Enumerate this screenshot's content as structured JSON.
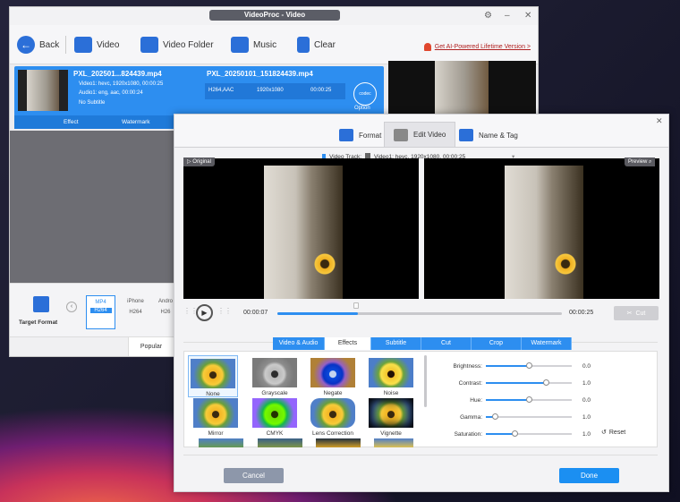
{
  "main": {
    "title": "VideoProc - Video",
    "toolbar": {
      "back": "Back",
      "video": "Video",
      "video_folder": "Video Folder",
      "music": "Music",
      "clear": "Clear"
    },
    "promo": "Get AI-Powered Lifetime Version >",
    "file": {
      "name_src": "PXL_202501...824439.mp4",
      "video_track": "Video1: hevc, 1920x1080, 00:00:25",
      "audio_track": "Audio1: eng, aac, 00:00:24",
      "subtitle": "No Subtitle",
      "name_out": "PXL_20250101_151824439.mp4",
      "codec": "H264,AAC",
      "resolution": "1920x1080",
      "duration": "00:00:25",
      "option": "Option",
      "codec_badge": "codec",
      "effect": "Effect",
      "watermark": "Watermark"
    },
    "target_format": "Target Format",
    "formats": [
      {
        "top": "MP4",
        "bottom": "H264"
      },
      {
        "top": "iPhone",
        "bottom": "H264"
      },
      {
        "top": "Andro",
        "bottom": "H26"
      }
    ],
    "popular_tab": "Popular"
  },
  "dialog": {
    "tabs": {
      "format": "Format",
      "edit_video": "Edit Video",
      "name_tag": "Name & Tag"
    },
    "video_track_label": "Video Track:",
    "video_track_value": "Video1: hevc, 1920x1080, 00:00:25",
    "original_label": "Original",
    "preview_label": "Preview",
    "time_current": "00:00:07",
    "time_total": "00:00:25",
    "cut": "Cut",
    "edit_tabs": [
      "Video & Audio",
      "Effects",
      "Subtitle",
      "Cut",
      "Crop",
      "Watermark"
    ],
    "effects": [
      "None",
      "Grayscale",
      "Negate",
      "Noise",
      "Mirror",
      "CMYK",
      "Lens Correction",
      "Vignette"
    ],
    "sliders": [
      {
        "label": "Brightness:",
        "value": "0.0",
        "level": 0.5
      },
      {
        "label": "Contrast:",
        "value": "1.0",
        "level": 0.7
      },
      {
        "label": "Hue:",
        "value": "0.0",
        "level": 0.5
      },
      {
        "label": "Gamma:",
        "value": "1.0",
        "level": 0.1
      },
      {
        "label": "Saturation:",
        "value": "1.0",
        "level": 0.33
      }
    ],
    "reset": "Reset",
    "cancel": "Cancel",
    "done": "Done"
  }
}
